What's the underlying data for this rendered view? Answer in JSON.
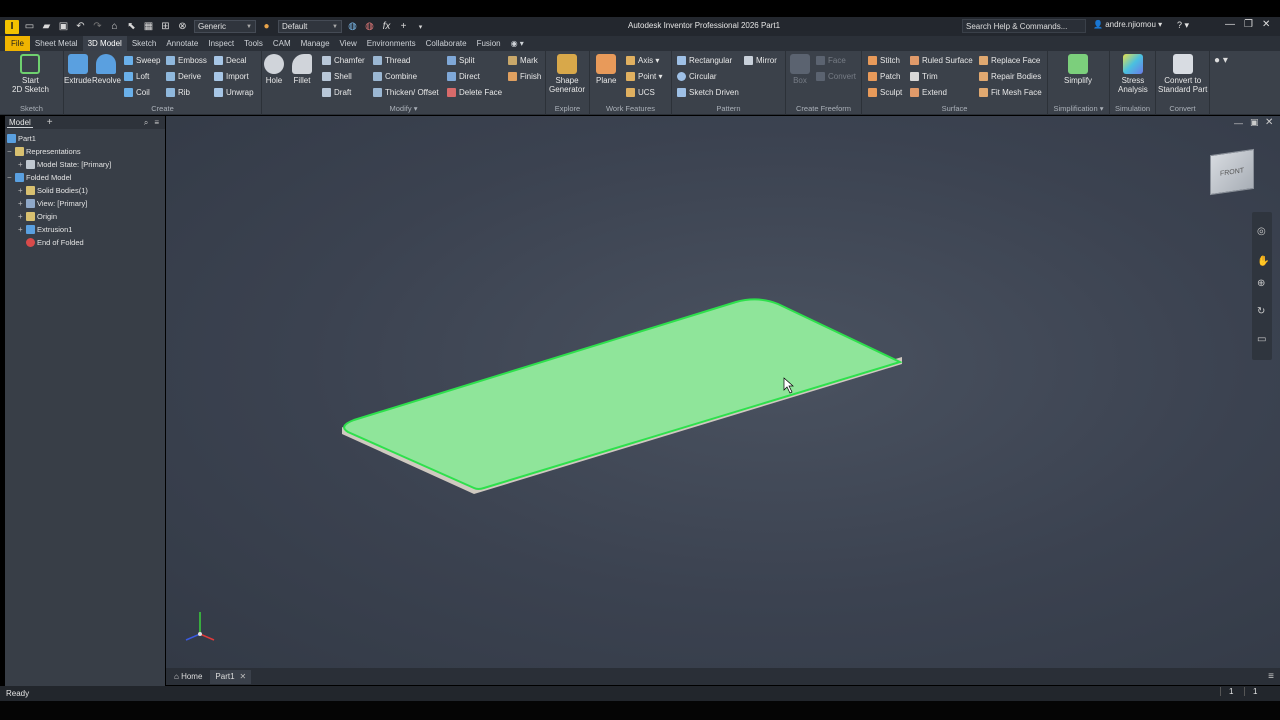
{
  "titlebar": {
    "logo": "I",
    "appearance_select": "Generic",
    "material_select": "Default",
    "title": "Autodesk Inventor Professional 2026   Part1",
    "search_placeholder": "Search Help & Commands...",
    "user": "andre.njiomou"
  },
  "menu": {
    "tabs": [
      "File",
      "Sheet Metal",
      "3D Model",
      "Sketch",
      "Annotate",
      "Inspect",
      "Tools",
      "CAM",
      "Manage",
      "View",
      "Environments",
      "Collaborate",
      "Fusion"
    ],
    "active": "3D Model"
  },
  "ribbon": {
    "sketch": {
      "title": "Sketch",
      "start": "Start\n2D Sketch"
    },
    "create": {
      "title": "Create",
      "extrude": "Extrude",
      "revolve": "Revolve",
      "sweep": "Sweep",
      "emboss": "Emboss",
      "decal": "Decal",
      "loft": "Loft",
      "derive": "Derive",
      "import": "Import",
      "coil": "Coil",
      "rib": "Rib",
      "unwrap": "Unwrap"
    },
    "modify": {
      "title": "Modify",
      "hole": "Hole",
      "fillet": "Fillet",
      "chamfer": "Chamfer",
      "thread": "Thread",
      "split": "Split",
      "mark": "Mark",
      "shell": "Shell",
      "combine": "Combine",
      "direct": "Direct",
      "finish": "Finish",
      "draft": "Draft",
      "thicken": "Thicken/ Offset",
      "delete_face": "Delete Face"
    },
    "explore": {
      "title": "Explore",
      "shape_generator": "Shape\nGenerator"
    },
    "work_features": {
      "title": "Work Features",
      "plane": "Plane",
      "axis": "Axis",
      "point": "Point",
      "ucs": "UCS"
    },
    "pattern": {
      "title": "Pattern",
      "rectangular": "Rectangular",
      "mirror": "Mirror",
      "circular": "Circular",
      "sketch_driven": "Sketch Driven"
    },
    "freeform": {
      "title": "Create Freeform",
      "box": "Box",
      "face": "Face",
      "convert": "Convert"
    },
    "surface": {
      "title": "Surface",
      "stitch": "Stitch",
      "ruled_surface": "Ruled Surface",
      "replace_face": "Replace Face",
      "patch": "Patch",
      "trim": "Trim",
      "repair_bodies": "Repair Bodies",
      "sculpt": "Sculpt",
      "extend": "Extend",
      "fit_mesh_face": "Fit Mesh Face"
    },
    "simplification": {
      "title": "Simplification",
      "simplify": "Simplify"
    },
    "simulation": {
      "title": "Simulation",
      "stress": "Stress\nAnalysis"
    },
    "convert": {
      "title": "Convert",
      "standard_part": "Convert to\nStandard Part"
    }
  },
  "browser": {
    "tab": "Model",
    "items": [
      "Part1",
      "Representations",
      "Model State: [Primary]",
      "Folded Model",
      "Solid Bodies(1)",
      "View: [Primary]",
      "Origin",
      "Extrusion1",
      "End of Folded"
    ]
  },
  "viewcube": {
    "face": "FRONT"
  },
  "doc_tabs": [
    "Home",
    "Part1"
  ],
  "status": {
    "text": "Ready",
    "count1": "1",
    "count2": "1"
  },
  "colors": {
    "accent": "#f0b400",
    "selected_body": "#8fe59a",
    "edge_highlight": "#2ee04c"
  }
}
